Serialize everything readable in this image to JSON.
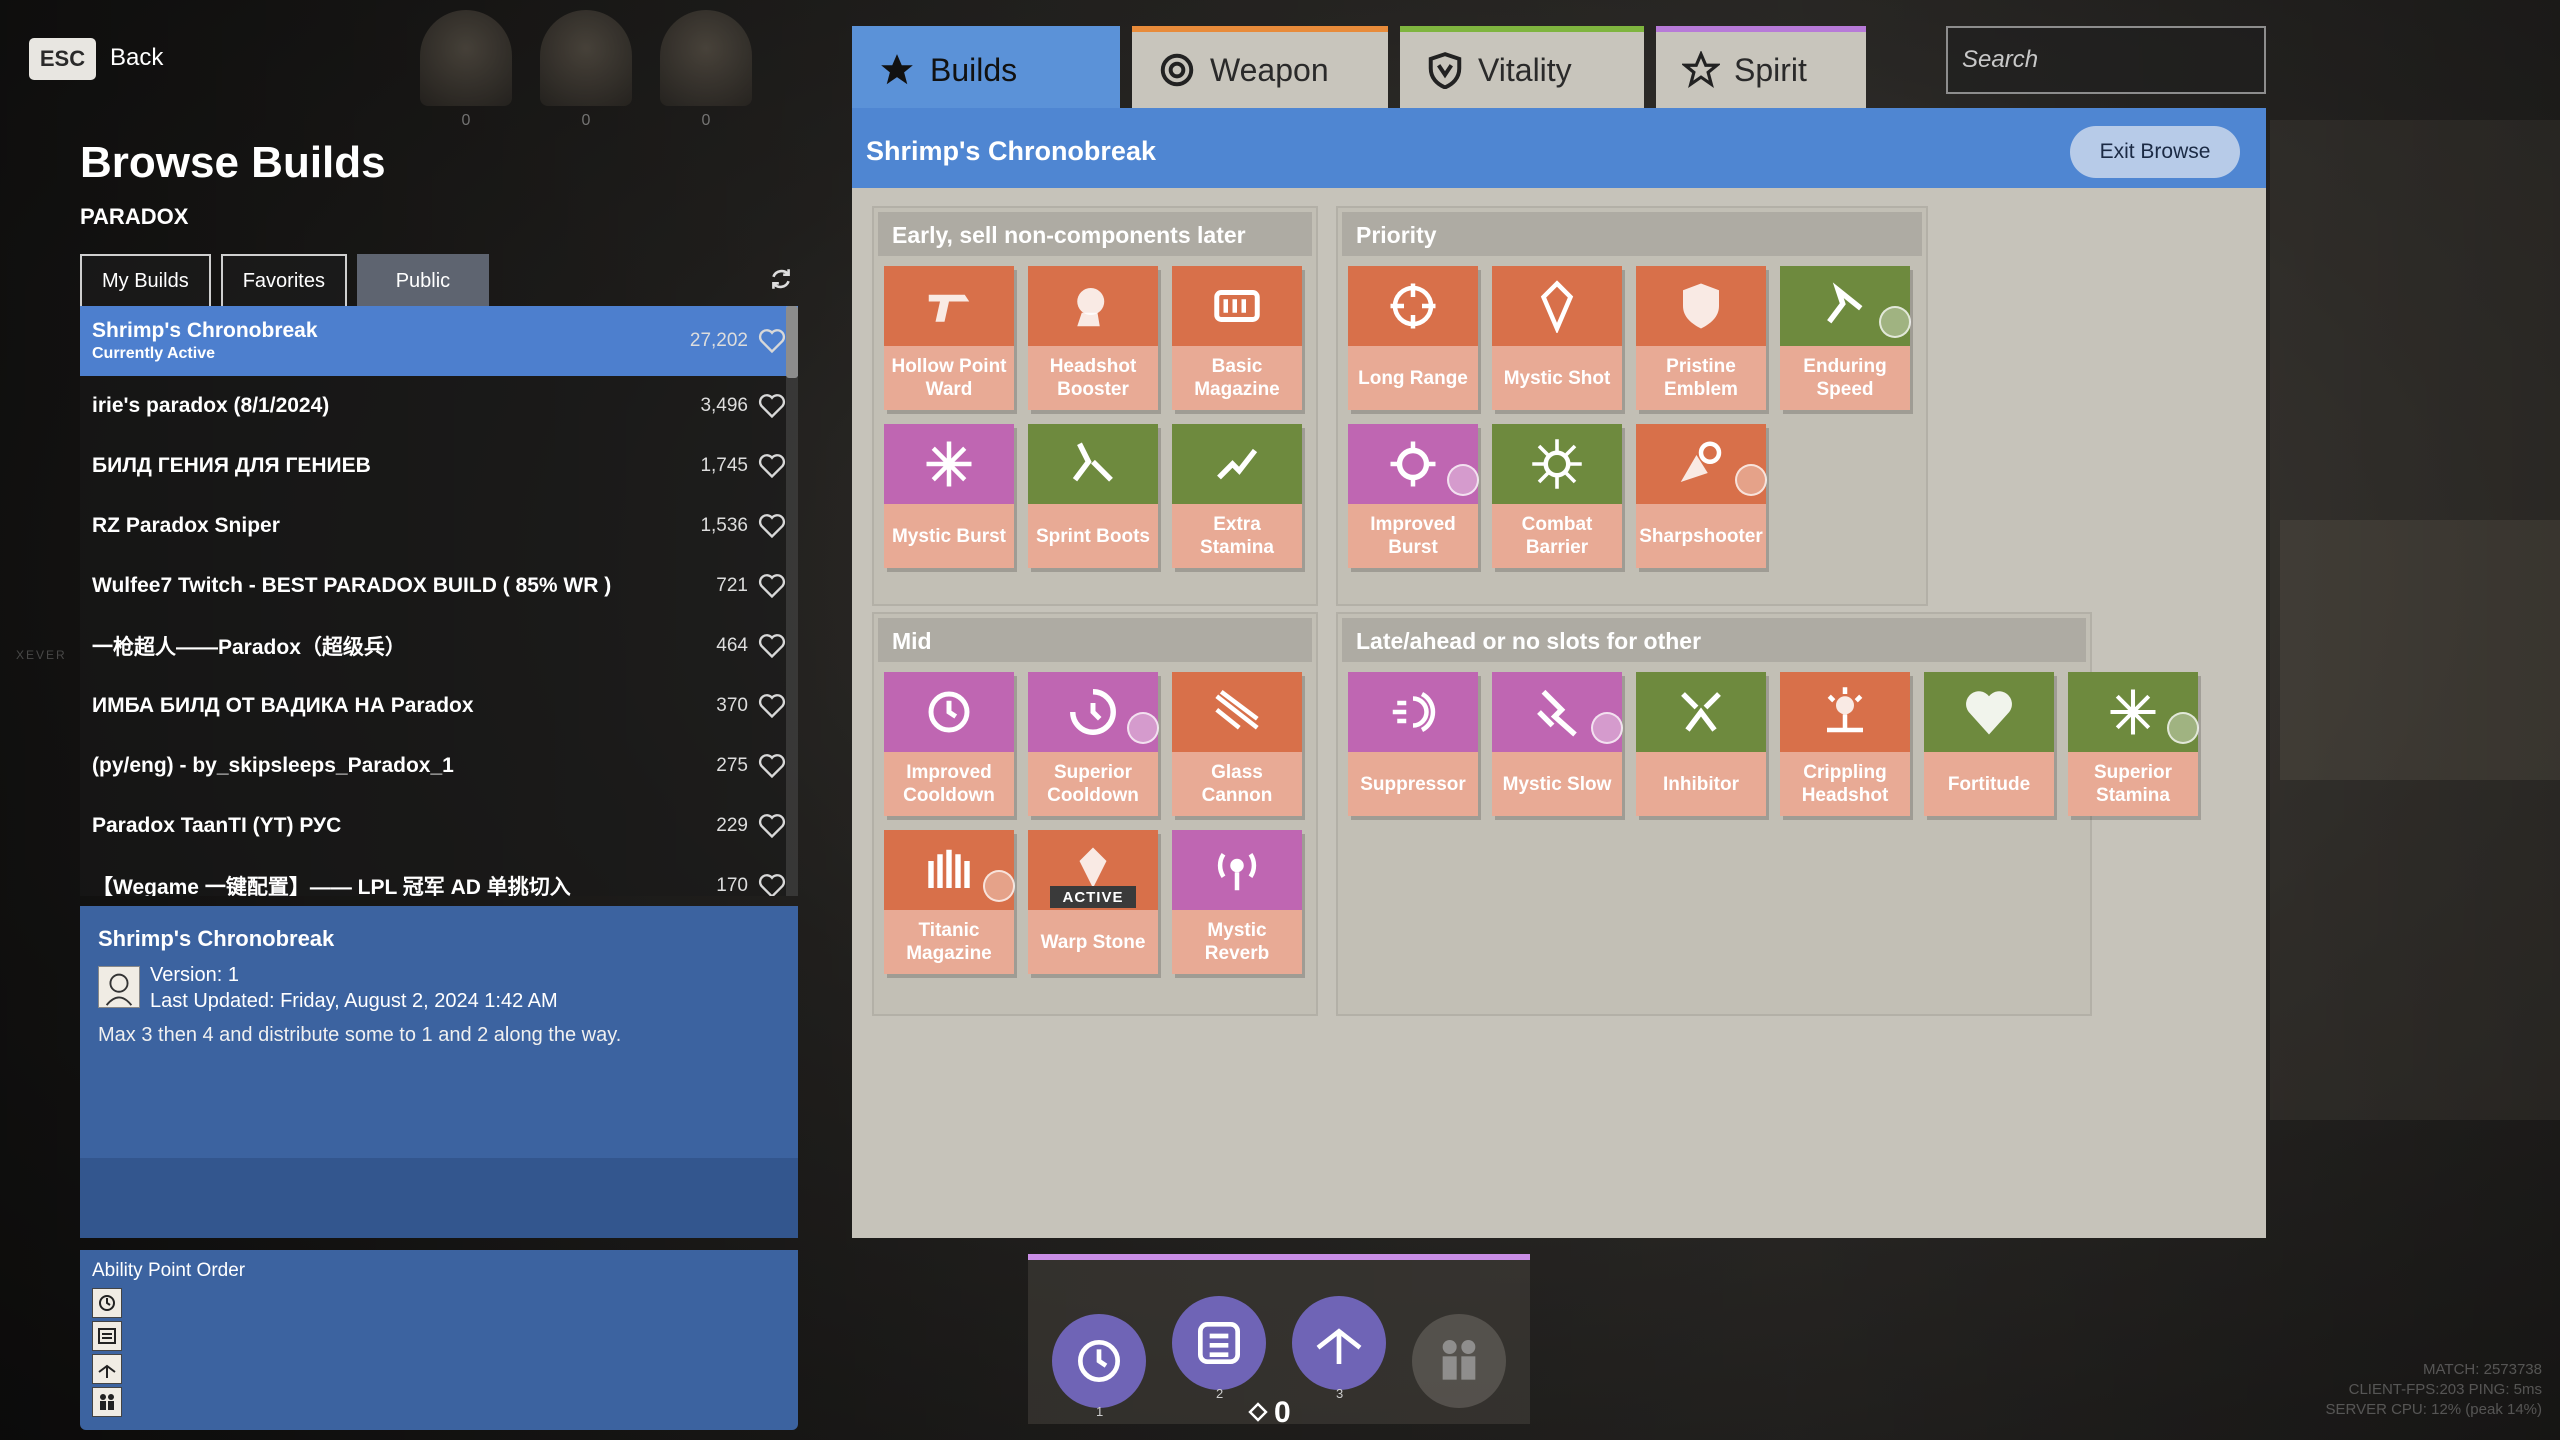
{
  "nav": {
    "esc_key": "ESC",
    "back_label": "Back"
  },
  "hero_portrait_values": [
    "0",
    "0",
    "0"
  ],
  "left": {
    "title": "Browse Builds",
    "hero": "PARADOX",
    "tabs": [
      "My Builds",
      "Favorites",
      "Public"
    ],
    "active_tab": "Public"
  },
  "builds": [
    {
      "name": "Shrimp's Chronobreak",
      "status": "Currently Active",
      "count": "27,202"
    },
    {
      "name": "irie's paradox (8/1/2024)",
      "count": "3,496"
    },
    {
      "name": "БИЛД ГЕНИЯ ДЛЯ ГЕНИЕВ",
      "count": "1,745"
    },
    {
      "name": "RZ Paradox Sniper",
      "count": "1,536"
    },
    {
      "name": "Wulfee7 Twitch - BEST PARADOX BUILD ( 85% WR )",
      "count": "721"
    },
    {
      "name": "一枪超人——Paradox（超级兵）",
      "count": "464"
    },
    {
      "name": "ИМБА БИЛД ОТ ВАДИКА НА Paradox",
      "count": "370"
    },
    {
      "name": "(py/eng) - by_skipsleeps_Paradox_1",
      "count": "275"
    },
    {
      "name": "Paradox TaanTI (YT) РУС",
      "count": "229"
    },
    {
      "name": "【Wegame 一键配置】—— LPL 冠军 AD 单挑切入",
      "count": "170"
    }
  ],
  "detail": {
    "title": "Shrimp's Chronobreak",
    "version": "Version: 1",
    "updated": "Last Updated: Friday, August 2, 2024 1:42 AM",
    "description": "Max 3 then 4 and distribute some to 1 and 2 along the way."
  },
  "ability_order": {
    "title": "Ability Point Order"
  },
  "top_tabs": [
    {
      "label": "Builds",
      "icon": "star-icon"
    },
    {
      "label": "Weapon",
      "icon": "weapon-icon"
    },
    {
      "label": "Vitality",
      "icon": "shield-icon"
    },
    {
      "label": "Spirit",
      "icon": "spirit-star-icon"
    }
  ],
  "search": {
    "placeholder": "Search",
    "value": ""
  },
  "panel": {
    "build_title": "Shrimp's Chronobreak",
    "exit_label": "Exit Browse"
  },
  "groups": [
    {
      "title": "Early, sell non-components later",
      "items": [
        {
          "name": "Hollow Point Ward",
          "color": "orange"
        },
        {
          "name": "Headshot Booster",
          "color": "orange"
        },
        {
          "name": "Basic Magazine",
          "color": "orange"
        },
        {
          "name": "Mystic Burst",
          "color": "purple"
        },
        {
          "name": "Sprint Boots",
          "color": "green"
        },
        {
          "name": "Extra Stamina",
          "color": "green"
        }
      ]
    },
    {
      "title": "Priority",
      "items": [
        {
          "name": "Long Range",
          "color": "orange"
        },
        {
          "name": "Mystic Shot",
          "color": "orange"
        },
        {
          "name": "Pristine Emblem",
          "color": "orange"
        },
        {
          "name": "Enduring Speed",
          "color": "green",
          "badge": true
        },
        {
          "name": "Improved Burst",
          "color": "purple",
          "badge": true
        },
        {
          "name": "Combat Barrier",
          "color": "green"
        },
        {
          "name": "Sharpshooter",
          "color": "orange",
          "badge": true
        }
      ]
    },
    {
      "title": "Mid",
      "items": [
        {
          "name": "Improved Cooldown",
          "color": "purple"
        },
        {
          "name": "Superior Cooldown",
          "color": "purple",
          "badge": true
        },
        {
          "name": "Glass Cannon",
          "color": "orange"
        },
        {
          "name": "Titanic Magazine",
          "color": "orange",
          "badge": true
        },
        {
          "name": "Warp Stone",
          "color": "orange",
          "active": "ACTIVE"
        },
        {
          "name": "Mystic Reverb",
          "color": "purple"
        }
      ]
    },
    {
      "title": "Late/ahead or no slots for other",
      "items": [
        {
          "name": "Suppressor",
          "color": "purple"
        },
        {
          "name": "Mystic Slow",
          "color": "purple",
          "badge": true
        },
        {
          "name": "Inhibitor",
          "color": "green"
        },
        {
          "name": "Crippling Headshot",
          "color": "orange"
        },
        {
          "name": "Fortitude",
          "color": "green"
        },
        {
          "name": "Superior Stamina",
          "color": "green",
          "badge": true
        }
      ]
    }
  ],
  "abilities": {
    "slots": [
      "1",
      "2",
      "3",
      ""
    ],
    "points": "0"
  },
  "stats": [
    "MATCH: 2573738",
    "CLIENT-FPS:203   PING: 5ms",
    "SERVER CPU: 12% (peak 14%)"
  ],
  "side_text": "XEVER"
}
